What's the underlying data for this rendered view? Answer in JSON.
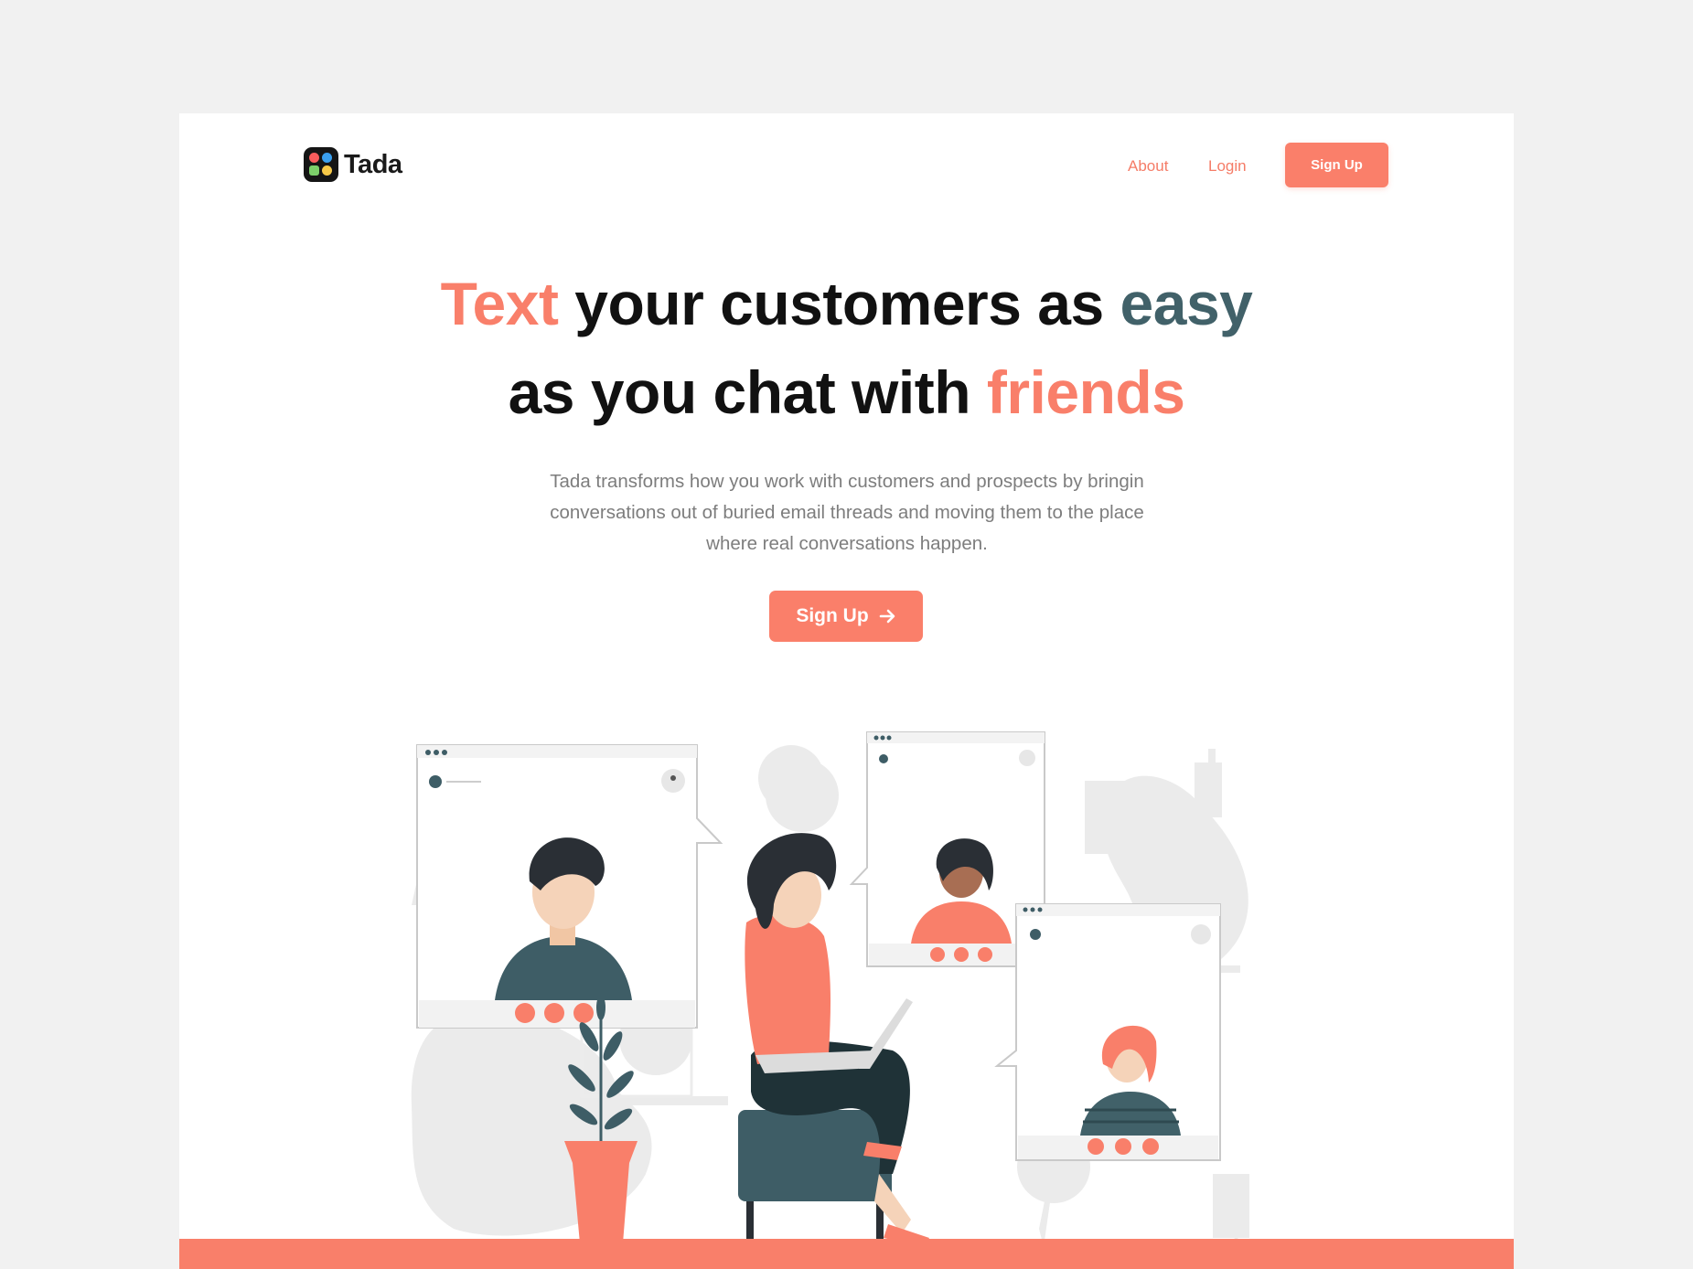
{
  "brand": {
    "name": "Tada"
  },
  "nav": {
    "links": [
      "About",
      "Login"
    ],
    "signup_label": "Sign Up"
  },
  "hero": {
    "line1": {
      "text": "Text",
      "middle": " your customers as ",
      "easy": "easy"
    },
    "line2": {
      "start": "as you chat with ",
      "friends": "friends"
    },
    "subtitle_lines": [
      "Tada transforms how you work with customers and prospects by bringin",
      "conversations out of buried email threads and moving them to the place",
      "where real conversations happen."
    ],
    "cta_label": "Sign Up",
    "cta_icon": "arrow-right-icon"
  },
  "colors": {
    "accent": "#fa7f6a",
    "slate": "#416169",
    "dark": "#111111",
    "background": "#f1f1f1"
  }
}
